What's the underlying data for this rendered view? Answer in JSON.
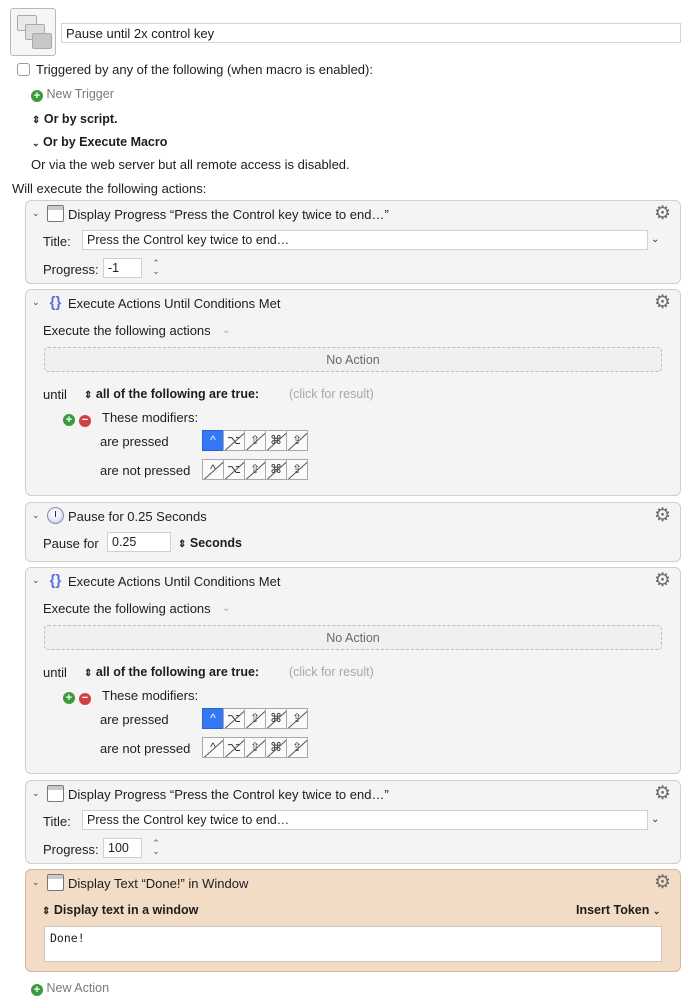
{
  "macro": {
    "name": "Pause until 2x control key"
  },
  "triggers": {
    "triggered_label": "Triggered by any of the following (when macro is enabled):",
    "new_trigger": "New Trigger",
    "or_by_script": "Or by script.",
    "or_by_execute_macro": "Or by Execute Macro",
    "web_server_note": "Or via the web server but all remote access is disabled.",
    "will_execute": "Will execute the following actions:"
  },
  "actions": [
    {
      "title": "Display Progress “Press the Control key twice to end…”",
      "title_label": "Title:",
      "title_value": "Press the Control key twice to end…",
      "progress_label": "Progress:",
      "progress_value": "-1"
    },
    {
      "title": "Execute Actions Until Conditions Met",
      "sub_label": "Execute the following actions",
      "no_action": "No Action",
      "until_label": "until",
      "condition": "all of the following are true:",
      "click_result": "(click for result)",
      "modifiers_label": "These modifiers:",
      "are_pressed": "are pressed",
      "are_not_pressed": "are not pressed"
    },
    {
      "title": "Pause for 0.25 Seconds",
      "pause_label": "Pause for",
      "pause_value": "0.25",
      "unit": "Seconds"
    },
    {
      "title": "Execute Actions Until Conditions Met",
      "sub_label": "Execute the following actions",
      "no_action": "No Action",
      "until_label": "until",
      "condition": "all of the following are true:",
      "click_result": "(click for result)",
      "modifiers_label": "These modifiers:",
      "are_pressed": "are pressed",
      "are_not_pressed": "are not pressed"
    },
    {
      "title": "Display Progress “Press the Control key twice to end…”",
      "title_label": "Title:",
      "title_value": "Press the Control key twice to end…",
      "progress_label": "Progress:",
      "progress_value": "100"
    },
    {
      "title": "Display Text “Done!” in Window",
      "mode": "Display text in a window",
      "insert_token": "Insert Token",
      "text": "Done!"
    }
  ],
  "modifier_keys": [
    "^",
    "⌥",
    "⇧",
    "⌘",
    "⇪"
  ],
  "footer": {
    "new_action": "New Action"
  },
  "colors": {
    "accent": "#3478f6",
    "display_text_bg": "#f2dcc6",
    "add_green": "#3c9b3c",
    "remove_red": "#d04040"
  }
}
